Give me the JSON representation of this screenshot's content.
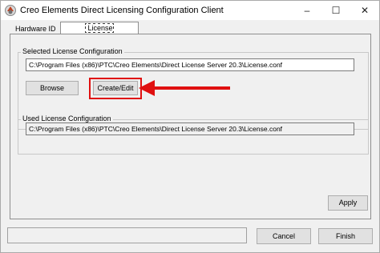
{
  "window": {
    "title": "Creo Elements Direct Licensing Configuration Client",
    "icon": "creo-app-icon",
    "controls": {
      "minimize": "–",
      "maximize": "☐",
      "close": "✕"
    }
  },
  "tabs": [
    {
      "label": "Hardware ID",
      "selected": false
    },
    {
      "label": "License Configuration",
      "selected": true
    }
  ],
  "selected_license": {
    "group_label": "Selected License Configuration",
    "path": "C:\\Program Files (x86)\\PTC\\Creo Elements\\Direct License Server 20.3\\License.conf",
    "browse_label": "Browse",
    "create_edit_label": "Create/Edit"
  },
  "used_license": {
    "group_label": "Used License Configuration",
    "path": "C:\\Program Files (x86)\\PTC\\Creo Elements\\Direct License Server 20.3\\License.conf"
  },
  "apply_label": "Apply",
  "status_text": "",
  "footer": {
    "cancel_label": "Cancel",
    "finish_label": "Finish"
  },
  "annotation": {
    "highlight_color": "#e01010",
    "arrow_color": "#e01010"
  }
}
